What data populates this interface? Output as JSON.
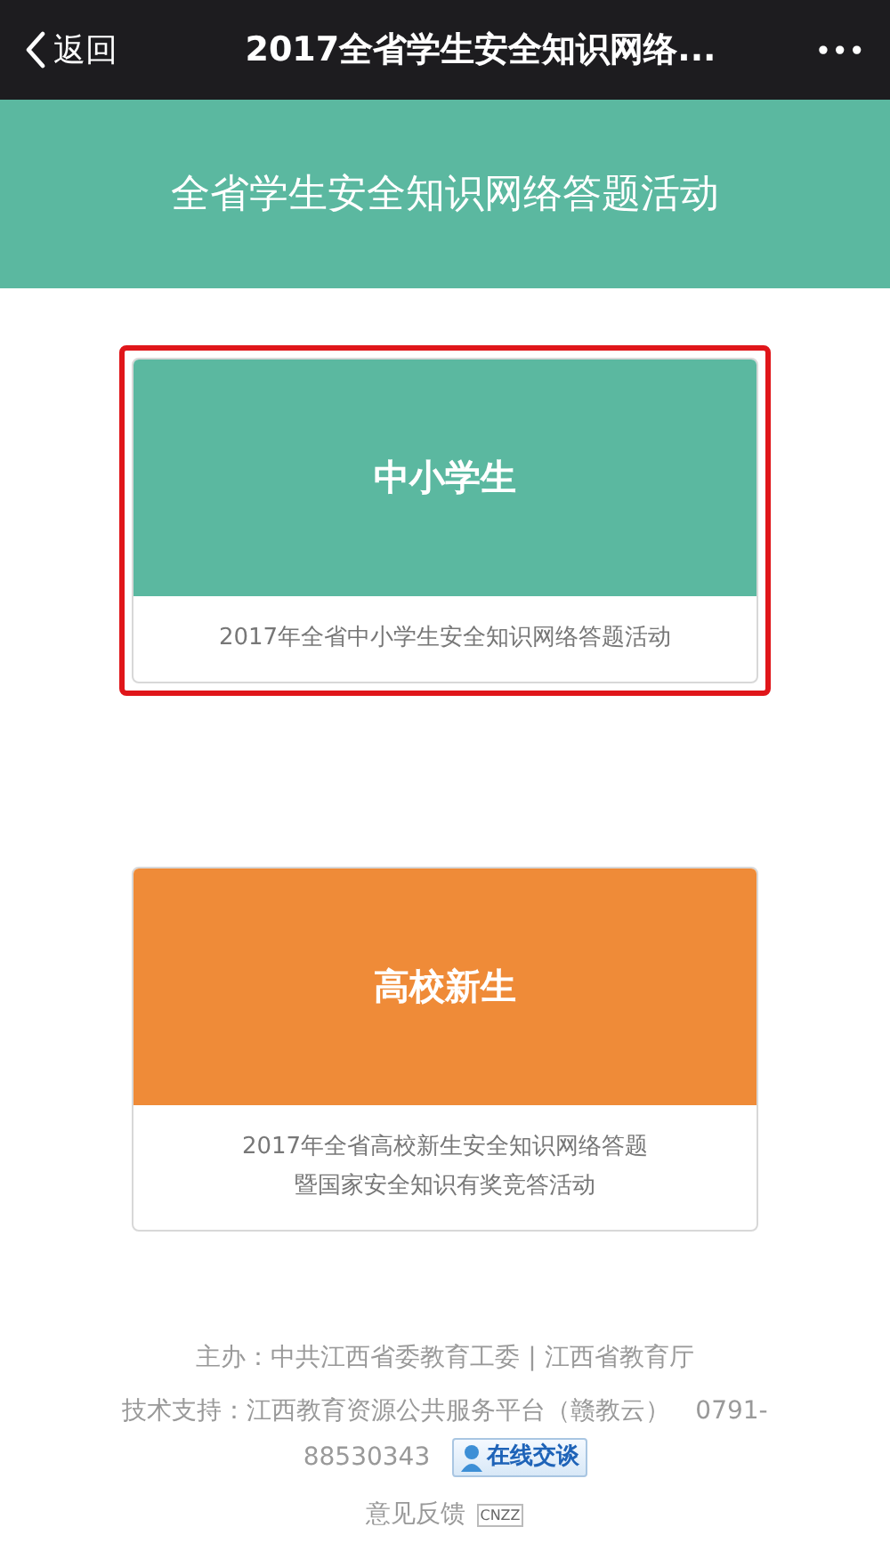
{
  "nav_bar": {
    "back": "返回",
    "title": "2017全省学生安全知识网络...",
    "more": "•••"
  },
  "banner": {
    "title": "全省学生安全知识网络答题活动"
  },
  "cards": [
    {
      "title": "中小学生",
      "caption": [
        "2017年全省中小学生安全知识网络答题活动"
      ],
      "color": "#5bb8a0",
      "selected": true
    },
    {
      "title": "高校新生",
      "caption": [
        "2017年全省高校新生安全知识网络答题",
        "暨国家安全知识有奖竞答活动"
      ],
      "color": "#ef8b38",
      "selected": false
    }
  ],
  "footer": {
    "sponsor": "主办：中共江西省委教育工委 | 江西省教育厅",
    "support": [
      "技术支持：江西教育资源公共服务平台（赣教云）　0791-",
      "88530343"
    ],
    "chat_button": "在线交谈",
    "feedback": "意见反馈",
    "stats_badge": "CNZZ"
  }
}
